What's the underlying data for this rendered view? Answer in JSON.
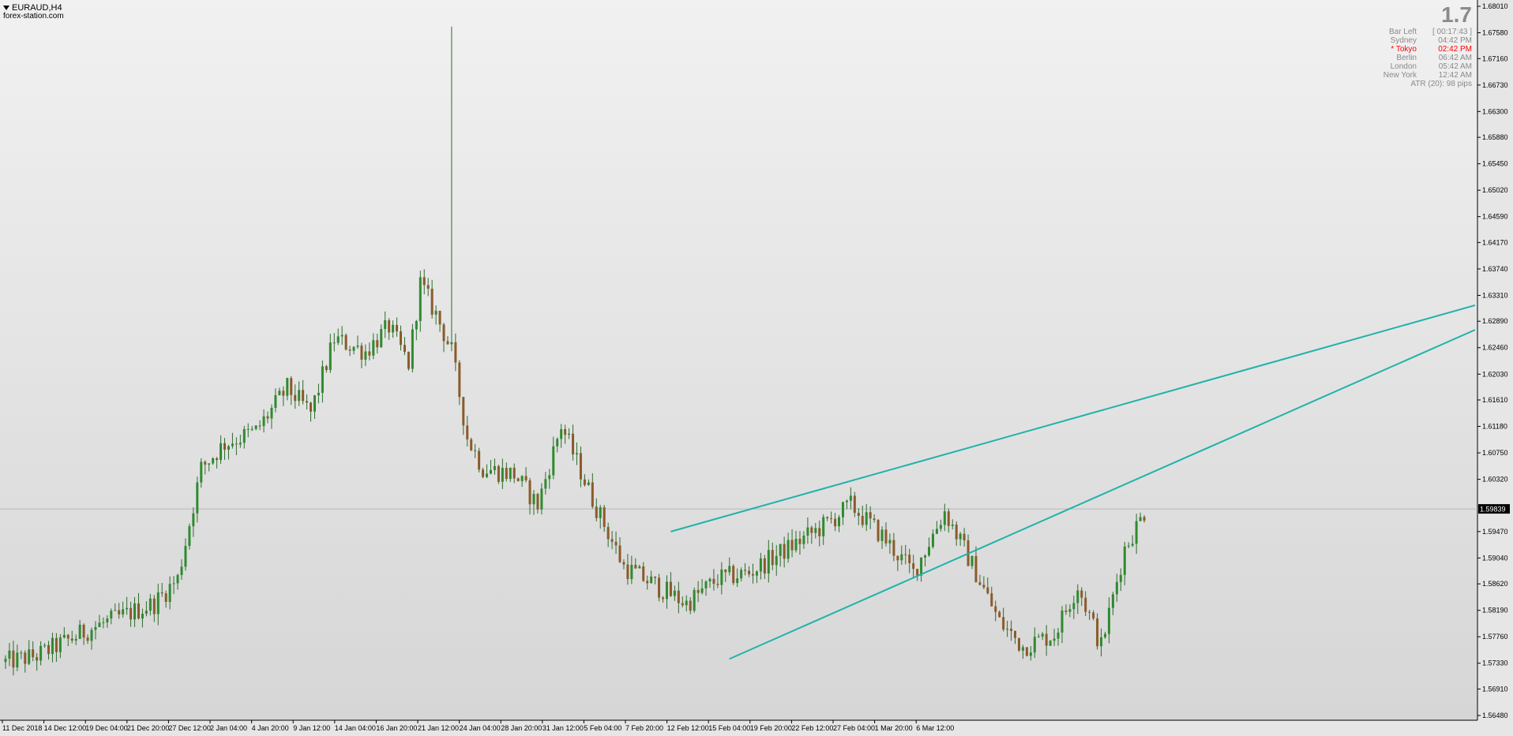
{
  "header": {
    "symbol": "EURAUD,H4",
    "watermark": "forex-station.com"
  },
  "info_panel": {
    "big_value": "1.7",
    "rows": [
      {
        "label": "Bar Left",
        "value": "[ 00:17:43 ]",
        "active": false
      },
      {
        "label": "Sydney",
        "value": "04:42 PM",
        "active": false
      },
      {
        "label": "* Tokyo",
        "value": "02:42 PM",
        "active": true
      },
      {
        "label": "Berlin",
        "value": "06:42 AM",
        "active": false
      },
      {
        "label": "London",
        "value": "05:42 AM",
        "active": false
      },
      {
        "label": "New York",
        "value": "12:42 AM",
        "active": false
      }
    ],
    "atr": "ATR (20): 98 pips"
  },
  "colors": {
    "background": "#e2e2e2",
    "axis": "#000000",
    "bull_body": "#2e8b2e",
    "bear_body": "#8b5a2b",
    "wick": "#2e6b2e",
    "trendline": "#20b2aa",
    "price_line": "#b8b8b8",
    "price_label_bg": "#000000",
    "price_label_text": "#ffffff"
  },
  "chart_data": {
    "type": "candlestick",
    "symbol": "EURAUD",
    "timeframe": "H4",
    "current_price": 1.59839,
    "current_price_label": "1.59839",
    "ylim": [
      1.5648,
      1.6801
    ],
    "y_ticks": [
      "1.68010",
      "1.67580",
      "1.67160",
      "1.66730",
      "1.66300",
      "1.65880",
      "1.65450",
      "1.65020",
      "1.64590",
      "1.64170",
      "1.63740",
      "1.63310",
      "1.62890",
      "1.62460",
      "1.62030",
      "1.61610",
      "1.61180",
      "1.60750",
      "1.60320",
      "1.59470",
      "1.59040",
      "1.58620",
      "1.58190",
      "1.57760",
      "1.57330",
      "1.56910",
      "1.56480"
    ],
    "x_ticks": [
      "11 Dec 2018",
      "14 Dec 12:00",
      "19 Dec 04:00",
      "21 Dec 20:00",
      "27 Dec 12:00",
      "2 Jan 04:00",
      "4 Jan 20:00",
      "9 Jan 12:00",
      "14 Jan 04:00",
      "16 Jan 20:00",
      "21 Jan 12:00",
      "24 Jan 04:00",
      "28 Jan 20:00",
      "31 Jan 12:00",
      "5 Feb 04:00",
      "7 Feb 20:00",
      "12 Feb 12:00",
      "15 Feb 04:00",
      "19 Feb 20:00",
      "22 Feb 12:00",
      "27 Feb 04:00",
      "1 Mar 20:00",
      "6 Mar 12:00"
    ],
    "candle_count": 292,
    "price_path": [
      [
        0,
        1.5735
      ],
      [
        8,
        1.5745
      ],
      [
        16,
        1.577
      ],
      [
        22,
        1.579
      ],
      [
        30,
        1.581
      ],
      [
        38,
        1.583
      ],
      [
        44,
        1.587
      ],
      [
        50,
        1.605
      ],
      [
        56,
        1.609
      ],
      [
        64,
        1.611
      ],
      [
        72,
        1.618
      ],
      [
        78,
        1.614
      ],
      [
        84,
        1.626
      ],
      [
        92,
        1.624
      ],
      [
        98,
        1.628
      ],
      [
        103,
        1.622
      ],
      [
        106,
        1.635
      ],
      [
        110,
        1.63
      ],
      [
        114,
        1.624
      ],
      [
        118,
        1.61
      ],
      [
        122,
        1.605
      ],
      [
        130,
        1.604
      ],
      [
        136,
        1.599
      ],
      [
        142,
        1.612
      ],
      [
        150,
        1.6
      ],
      [
        158,
        1.589
      ],
      [
        166,
        1.586
      ],
      [
        174,
        1.583
      ],
      [
        182,
        1.587
      ],
      [
        190,
        1.588
      ],
      [
        200,
        1.592
      ],
      [
        210,
        1.596
      ],
      [
        216,
        1.599
      ],
      [
        224,
        1.594
      ],
      [
        232,
        1.588
      ],
      [
        240,
        1.598
      ],
      [
        248,
        1.588
      ],
      [
        254,
        1.58
      ],
      [
        260,
        1.576
      ],
      [
        268,
        1.578
      ],
      [
        274,
        1.586
      ],
      [
        280,
        1.576
      ],
      [
        286,
        1.592
      ],
      [
        292,
        1.599
      ]
    ],
    "annotations": [
      {
        "type": "spike_high",
        "price": 1.6768,
        "label": ""
      },
      {
        "type": "trendline",
        "from": [
          170,
          1.5947
        ],
        "to": [
          292,
          1.6315
        ]
      },
      {
        "type": "trendline",
        "from": [
          185,
          1.574
        ],
        "to": [
          292,
          1.6275
        ]
      }
    ],
    "grid": false,
    "legend": "none"
  }
}
